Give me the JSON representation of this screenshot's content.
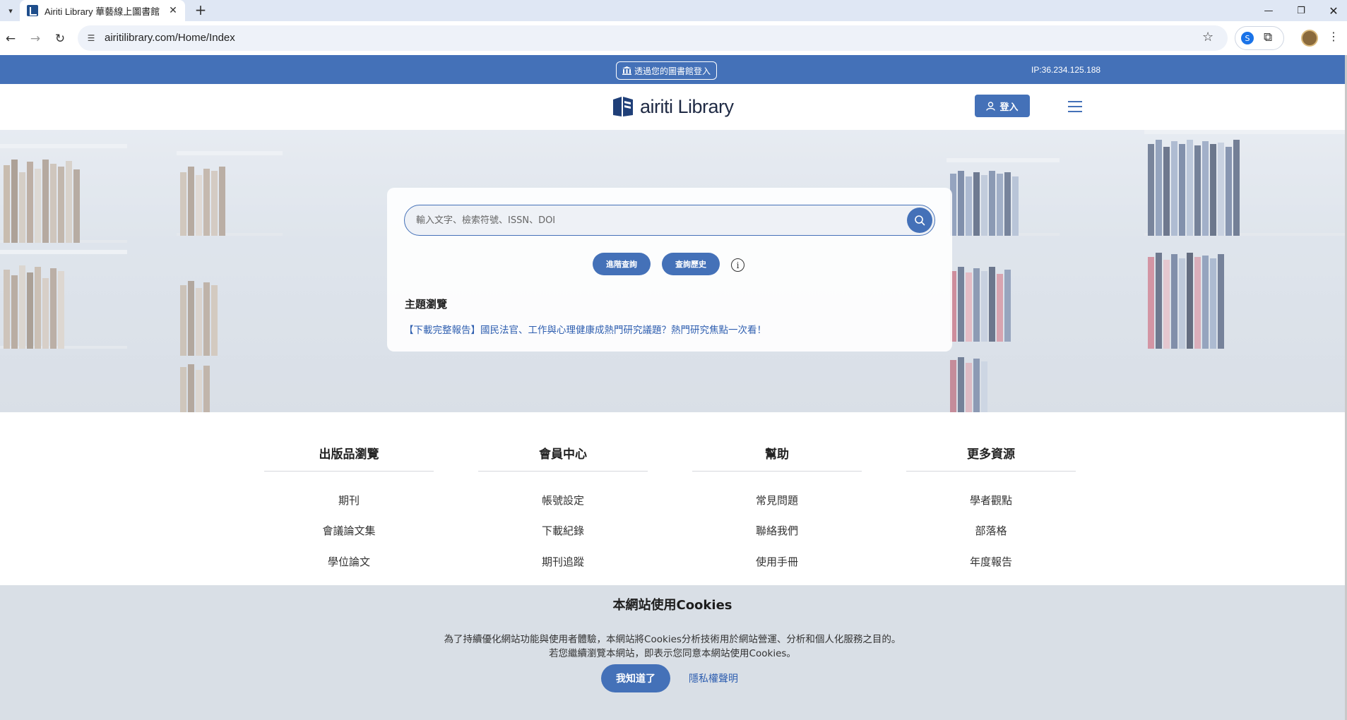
{
  "browser": {
    "tab_title": "Airiti Library 華藝線上圖書館",
    "url": "airitilibrary.com/Home/Index"
  },
  "topbar": {
    "library_login": "透過您的圖書館登入",
    "ip": "IP:36.234.125.188"
  },
  "header": {
    "logo_text": "airiti Library",
    "login_label": "登入"
  },
  "search": {
    "placeholder": "輸入文字、檢索符號、ISSN、DOI",
    "value": "",
    "advanced_label": "進階查詢",
    "history_label": "查詢歷史",
    "info_symbol": "i",
    "topic_heading": "主題瀏覽",
    "topic_link": "【下載完整報告】國民法官、工作與心理健康成熱門研究議題？熱門研究焦點一次看！"
  },
  "footer": {
    "columns": [
      {
        "title": "出版品瀏覽",
        "links": [
          "期刊",
          "會議論文集",
          "學位論文"
        ]
      },
      {
        "title": "會員中心",
        "links": [
          "帳號設定",
          "下載紀錄",
          "期刊追蹤"
        ]
      },
      {
        "title": "幫助",
        "links": [
          "常見問題",
          "聯絡我們",
          "使用手冊"
        ]
      },
      {
        "title": "更多資源",
        "links": [
          "學者觀點",
          "部落格",
          "年度報告"
        ]
      }
    ]
  },
  "cookie": {
    "title": "本網站使用Cookies",
    "text_line1": "為了持續優化網站功能與使用者體驗，本網站將Cookies分析技術用於網站營運、分析和個人化服務之目的。",
    "text_line2": "若您繼續瀏覽本網站，即表示您同意本網站使用Cookies。",
    "accept_label": "我知道了",
    "privacy_label": "隱私權聲明"
  },
  "colors": {
    "brand_blue": "#4471b8",
    "link_blue": "#2f5fb0",
    "cookie_bg": "#d9dfe6"
  },
  "icons": [
    "back-icon",
    "forward-icon",
    "reload-icon",
    "site-info-icon",
    "star-icon",
    "extension-icon",
    "kebab-icon",
    "library-icon",
    "user-icon",
    "hamburger-icon",
    "search-icon",
    "info-icon"
  ]
}
